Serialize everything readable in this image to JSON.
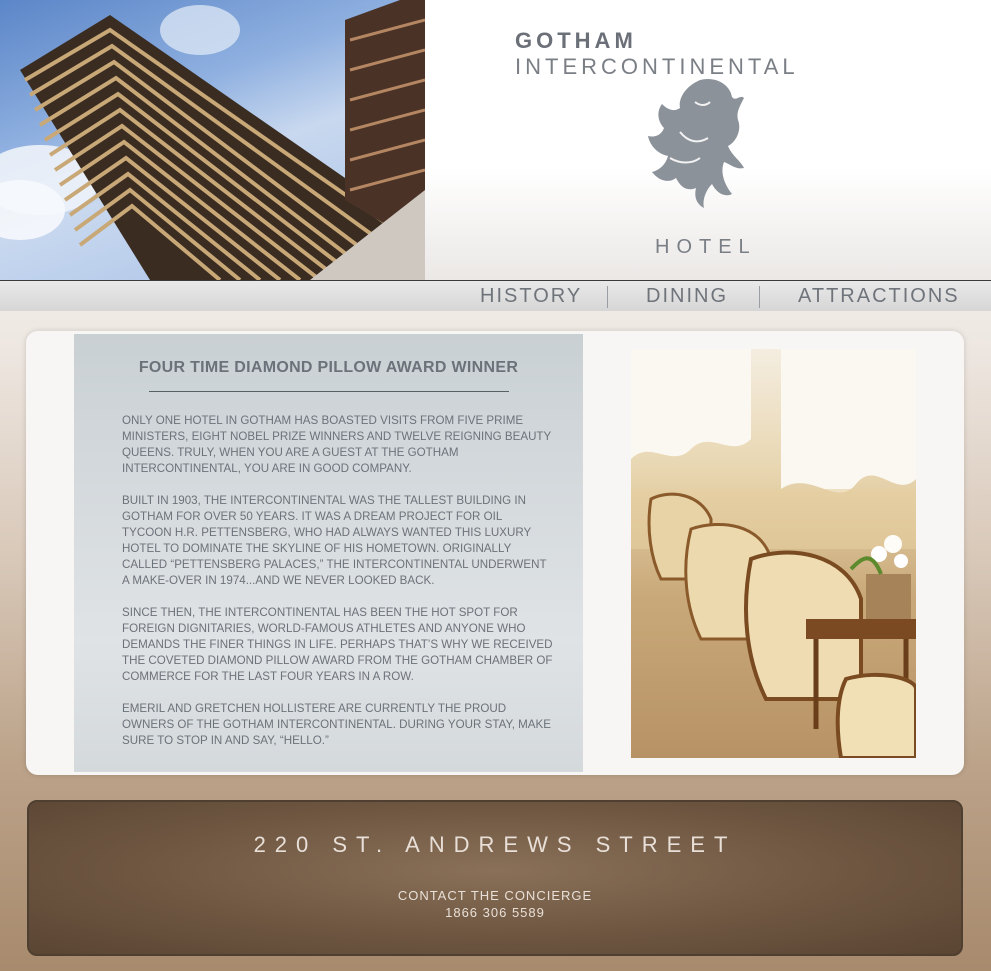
{
  "brand": {
    "name_bold": "GOTHAM",
    "name_light": "INTERCONTINENTAL",
    "sub": "HOTEL"
  },
  "nav": {
    "items": [
      {
        "label": "HISTORY"
      },
      {
        "label": "DINING"
      },
      {
        "label": "ATTRACTIONS"
      }
    ]
  },
  "main": {
    "title": "FOUR TIME DIAMOND PILLOW AWARD WINNER",
    "paragraphs": [
      "ONLY ONE HOTEL IN GOTHAM HAS BOASTED VISITS FROM FIVE PRIME MINISTERS, EIGHT NOBEL PRIZE WINNERS AND TWELVE REIGNING BEAUTY QUEENS. TRULY, WHEN YOU ARE A GUEST AT THE GOTHAM INTERCONTINENTAL, YOU ARE IN GOOD COMPANY.",
      "BUILT IN 1903, THE INTERCONTINENTAL WAS THE TALLEST BUILDING IN GOTHAM FOR OVER 50 YEARS. IT WAS A DREAM PROJECT FOR OIL TYCOON H.R. PETTENSBERG, WHO HAD ALWAYS WANTED THIS LUXURY HOTEL TO DOMINATE THE SKYLINE OF HIS HOMETOWN. ORIGINALLY CALLED “PETTENSBERG PALACES,” THE INTERCONTINENTAL UNDERWENT A MAKE-OVER IN 1974...AND WE NEVER LOOKED BACK.",
      "SINCE THEN, THE INTERCONTINENTAL HAS BEEN THE HOT SPOT FOR FOREIGN DIGNITARIES, WORLD-FAMOUS ATHLETES AND ANYONE WHO DEMANDS THE FINER THINGS IN LIFE. PERHAPS THAT’S WHY WE RECEIVED THE COVETED DIAMOND PILLOW AWARD FROM THE GOTHAM CHAMBER OF COMMERCE FOR THE LAST FOUR YEARS IN A ROW.",
      "EMERIL AND GRETCHEN HOLLISTERE ARE CURRENTLY THE PROUD OWNERS OF THE GOTHAM INTERCONTINENTAL. DURING YOUR STAY, MAKE SURE TO STOP IN AND SAY, “HELLO.”"
    ]
  },
  "footer": {
    "address": "220 ST. ANDREWS STREET",
    "concierge_label": "CONTACT THE CONCIERGE",
    "phone": "1866 306 5589"
  },
  "colors": {
    "text_gray": "#6c727a",
    "footer_text": "#e8e0d8",
    "footer_border": "#4f3f30"
  },
  "icons": {
    "crest": "lion-rampant-icon"
  }
}
